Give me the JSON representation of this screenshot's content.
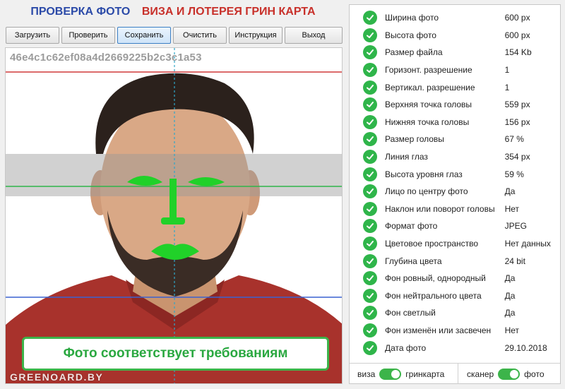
{
  "header": {
    "title_left": "ПРОВЕРКА ФОТО",
    "title_right": "ВИЗА И ЛОТЕРЕЯ ГРИН КАРТА"
  },
  "toolbar": {
    "load": "Загрузить",
    "check": "Проверить",
    "save": "Сохранить",
    "clear": "Очистить",
    "instructions": "Инструкция",
    "exit": "Выход"
  },
  "photo": {
    "hash": "46e4c1c62ef08a4d2669225b2c3c1a53",
    "result": "Фото соответствует требованиям",
    "watermark": "GREENOARD.BY"
  },
  "checks": [
    {
      "label": "Ширина фото",
      "value": "600 px"
    },
    {
      "label": "Высота фото",
      "value": "600 px"
    },
    {
      "label": "Размер файла",
      "value": "154 Kb"
    },
    {
      "label": "Горизонт. разрешение",
      "value": "1"
    },
    {
      "label": "Вертикал. разрешение",
      "value": "1"
    },
    {
      "label": "Верхняя точка головы",
      "value": "559 px"
    },
    {
      "label": "Нижняя точка головы",
      "value": "156 px"
    },
    {
      "label": "Размер головы",
      "value": "67 %"
    },
    {
      "label": "Линия глаз",
      "value": "354 px"
    },
    {
      "label": "Высота уровня глаз",
      "value": "59 %"
    },
    {
      "label": "Лицо по центру фото",
      "value": "Да"
    },
    {
      "label": "Наклон или поворот головы",
      "value": "Нет"
    },
    {
      "label": "Формат фото",
      "value": "JPEG"
    },
    {
      "label": "Цветовое пространство",
      "value": "Нет данных"
    },
    {
      "label": "Глубина цвета",
      "value": "24 bit"
    },
    {
      "label": "Фон ровный, однородный",
      "value": "Да"
    },
    {
      "label": "Фон нейтрального цвета",
      "value": "Да"
    },
    {
      "label": "Фон светлый",
      "value": "Да"
    },
    {
      "label": "Фон изменён или засвечен",
      "value": "Нет"
    },
    {
      "label": "Дата фото",
      "value": "29.10.2018"
    }
  ],
  "footer": {
    "left_off": "виза",
    "left_on": "гринкарта",
    "right_off": "сканер",
    "right_on": "фото"
  },
  "colors": {
    "accent_green": "#3cb44a",
    "title_blue": "#2b4aa8",
    "title_red": "#c8302a"
  }
}
